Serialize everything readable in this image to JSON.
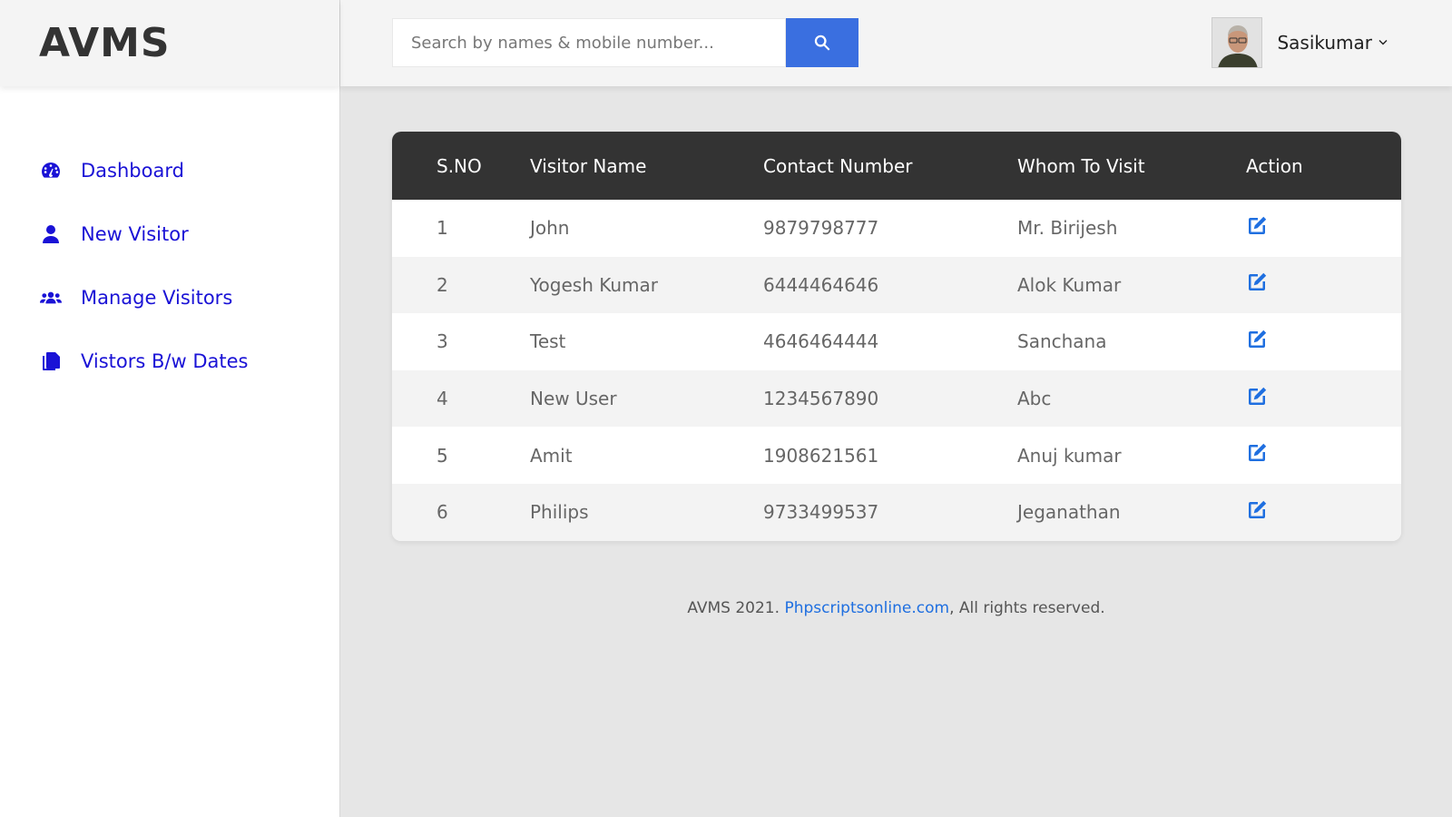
{
  "brand": "AVMS",
  "search": {
    "placeholder": "Search by names & mobile number...",
    "button_icon": "search-icon"
  },
  "user": {
    "name": "Sasikumar",
    "caret_icon": "chevron-down-icon"
  },
  "sidebar": {
    "items": [
      {
        "label": "Dashboard",
        "icon": "dashboard-gauge-icon"
      },
      {
        "label": "New Visitor",
        "icon": "user-icon"
      },
      {
        "label": "Manage Visitors",
        "icon": "users-icon"
      },
      {
        "label": "Vistors B/w Dates",
        "icon": "copy-icon"
      }
    ],
    "color": "#1a12d6"
  },
  "table": {
    "headers": [
      "S.NO",
      "Visitor Name",
      "Contact Number",
      "Whom To Visit",
      "Action"
    ],
    "rows": [
      {
        "sno": "1",
        "name": "John",
        "contact": "9879798777",
        "whom": "Mr. Birijesh"
      },
      {
        "sno": "2",
        "name": "Yogesh Kumar",
        "contact": "6444464646",
        "whom": "Alok Kumar"
      },
      {
        "sno": "3",
        "name": "Test",
        "contact": "4646464444",
        "whom": "Sanchana"
      },
      {
        "sno": "4",
        "name": "New User",
        "contact": "1234567890",
        "whom": "Abc"
      },
      {
        "sno": "5",
        "name": "Amit",
        "contact": "1908621561",
        "whom": "Anuj kumar"
      },
      {
        "sno": "6",
        "name": "Philips",
        "contact": "9733499537",
        "whom": "Jeganathan"
      }
    ],
    "action_icon": "edit-icon",
    "header_bg": "#333333",
    "action_color": "#1f6fe0"
  },
  "footer": {
    "prefix": "AVMS 2021. ",
    "link": "Phpscriptsonline.com",
    "suffix": ", All rights reserved."
  },
  "colors": {
    "accent": "#3a6fe0",
    "link": "#1f6fe0"
  }
}
